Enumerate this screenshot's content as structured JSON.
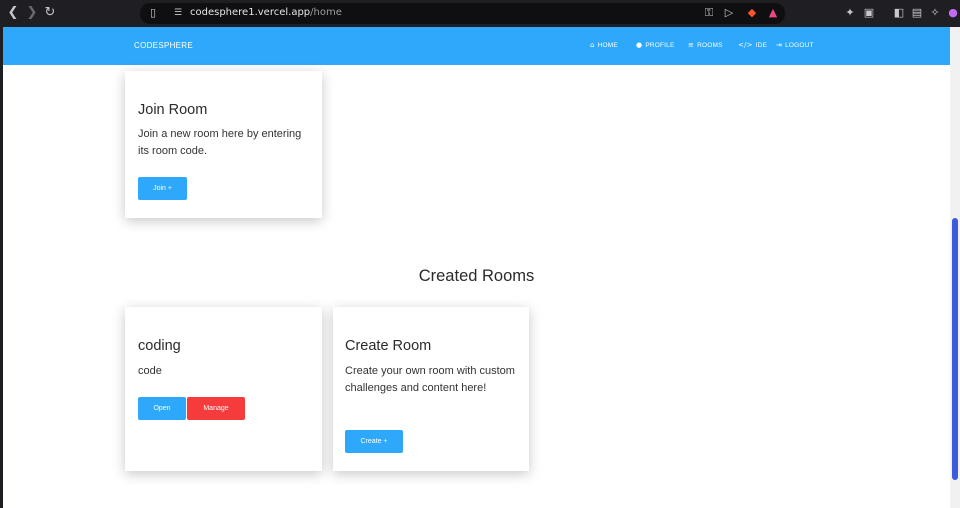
{
  "browser": {
    "back_icon": "chevron-left-icon",
    "forward_icon": "chevron-right-icon",
    "reload_icon": "reload-icon",
    "url_host": "codesphere1.vercel.app",
    "url_path": "/home"
  },
  "navbar": {
    "brand": "CODESPHERE",
    "links": [
      {
        "label": "HOME",
        "icon": "home-icon"
      },
      {
        "label": "PROFILE",
        "icon": "user-icon"
      },
      {
        "label": "ROOMS",
        "icon": "list-icon"
      },
      {
        "label": "IDE",
        "icon": "code-icon"
      },
      {
        "label": "LOGOUT",
        "icon": "logout-icon"
      }
    ],
    "color": "#2ea8fb"
  },
  "join_card": {
    "title": "Join Room",
    "text": "Join a new room here by entering its room code.",
    "button": "Join +"
  },
  "created_section": {
    "title": "Created Rooms"
  },
  "rooms": [
    {
      "title": "coding",
      "description": "code",
      "open_label": "Open",
      "manage_label": "Manage"
    }
  ],
  "create_card": {
    "title": "Create Room",
    "text": "Create your own room with custom challenges and content here!",
    "button": "Create +"
  },
  "colors": {
    "primary": "#2ea8fb",
    "danger": "#f53b3b"
  }
}
